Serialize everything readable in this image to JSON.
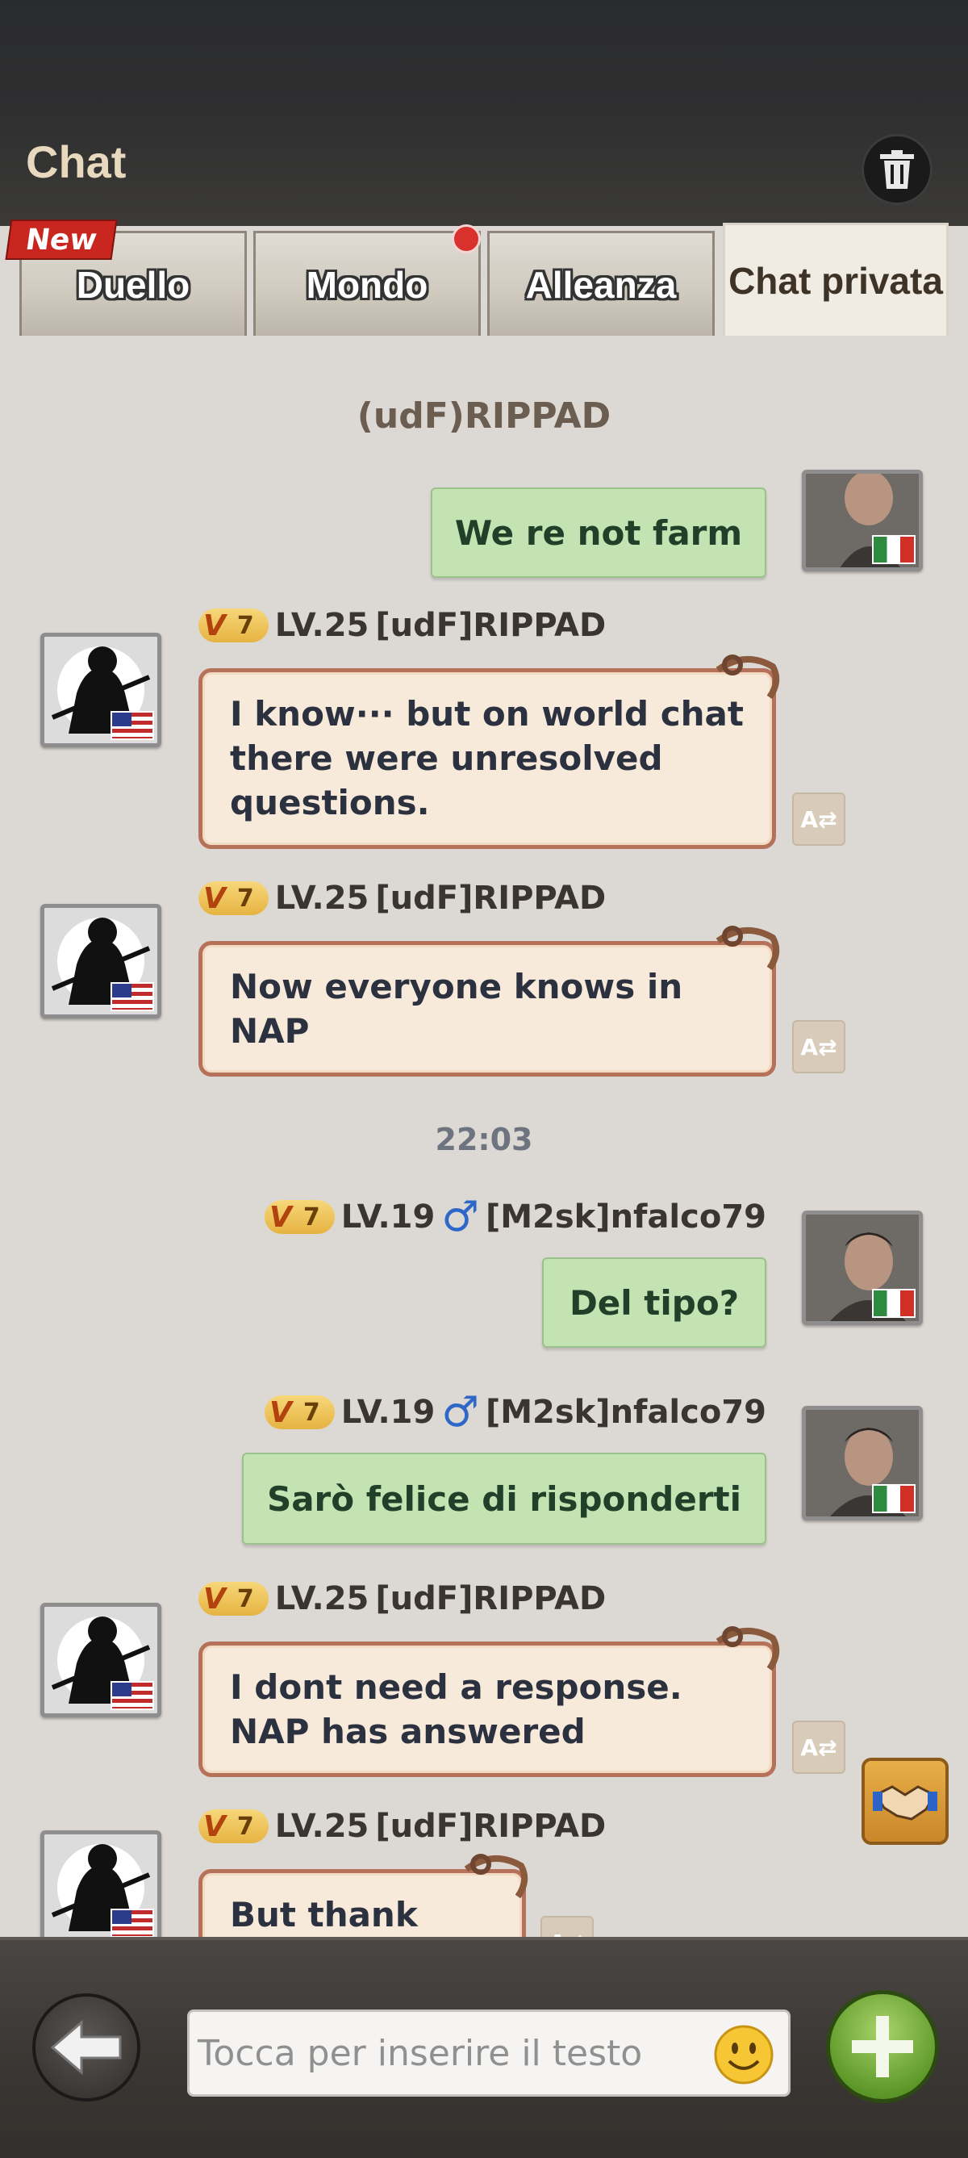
{
  "header": {
    "title": "Chat",
    "trash_icon": "trash-icon"
  },
  "tabs": [
    {
      "label": "Duello",
      "badge": "New",
      "active": false
    },
    {
      "label": "Mondo",
      "notification_dot": true,
      "active": false
    },
    {
      "label": "Alleanza",
      "active": false
    },
    {
      "label": "Chat privata",
      "active": true
    }
  ],
  "conversation": {
    "title": "(udF)RIPPAD"
  },
  "messages": [
    {
      "side": "right",
      "text": "We re not farm",
      "flag": "italy-flag"
    },
    {
      "side": "left",
      "vip": "7",
      "level": "LV.25",
      "name": "[udF]RIPPAD",
      "text": "I know··· but on world chat there were unresolved questions.",
      "flag": "usa-flag"
    },
    {
      "side": "left",
      "vip": "7",
      "level": "LV.25",
      "name": "[udF]RIPPAD",
      "text": "Now everyone knows in NAP",
      "flag": "usa-flag"
    },
    {
      "timestamp": "22:03"
    },
    {
      "side": "right",
      "vip": "7",
      "level": "LV.19",
      "gender": "♂",
      "name": "[M2sk]nfalco79",
      "text": "Del tipo?",
      "flag": "italy-flag"
    },
    {
      "side": "right",
      "vip": "7",
      "level": "LV.19",
      "gender": "♂",
      "name": "[M2sk]nfalco79",
      "text": "Sarò felice di risponderti",
      "flag": "italy-flag"
    },
    {
      "side": "left",
      "vip": "7",
      "level": "LV.25",
      "name": "[udF]RIPPAD",
      "text": "I dont need a response. NAP has answered",
      "flag": "usa-flag"
    },
    {
      "side": "left",
      "vip": "7",
      "level": "LV.25",
      "name": "[udF]RIPPAD",
      "text": "But thank you",
      "flag": "usa-flag"
    }
  ],
  "input": {
    "placeholder": "Tocca per inserire il testo"
  },
  "colors": {
    "incoming_bubble": "#f8eadb",
    "outgoing_bubble": "#c4e3b2",
    "bubble_border": "#b5715a",
    "vip_gold": "#e6b341"
  }
}
